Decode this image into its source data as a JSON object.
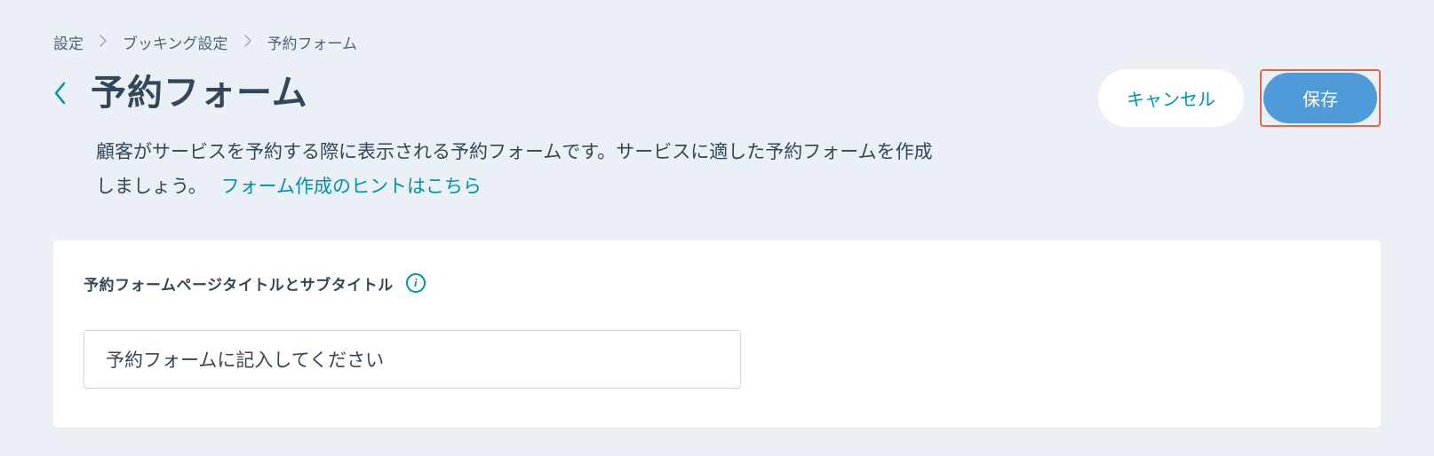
{
  "breadcrumb": {
    "items": [
      "設定",
      "ブッキング設定",
      "予約フォーム"
    ]
  },
  "header": {
    "title": "予約フォーム",
    "cancel_label": "キャンセル",
    "save_label": "保存"
  },
  "description": {
    "text": "顧客がサービスを予約する際に表示される予約フォームです。サービスに適した予約フォームを作成しましょう。",
    "link_text": "フォーム作成のヒントはこちら"
  },
  "form": {
    "section_title": "予約フォームページタイトルとサブタイトル",
    "title_input_value": "予約フォームに記入してください"
  }
}
